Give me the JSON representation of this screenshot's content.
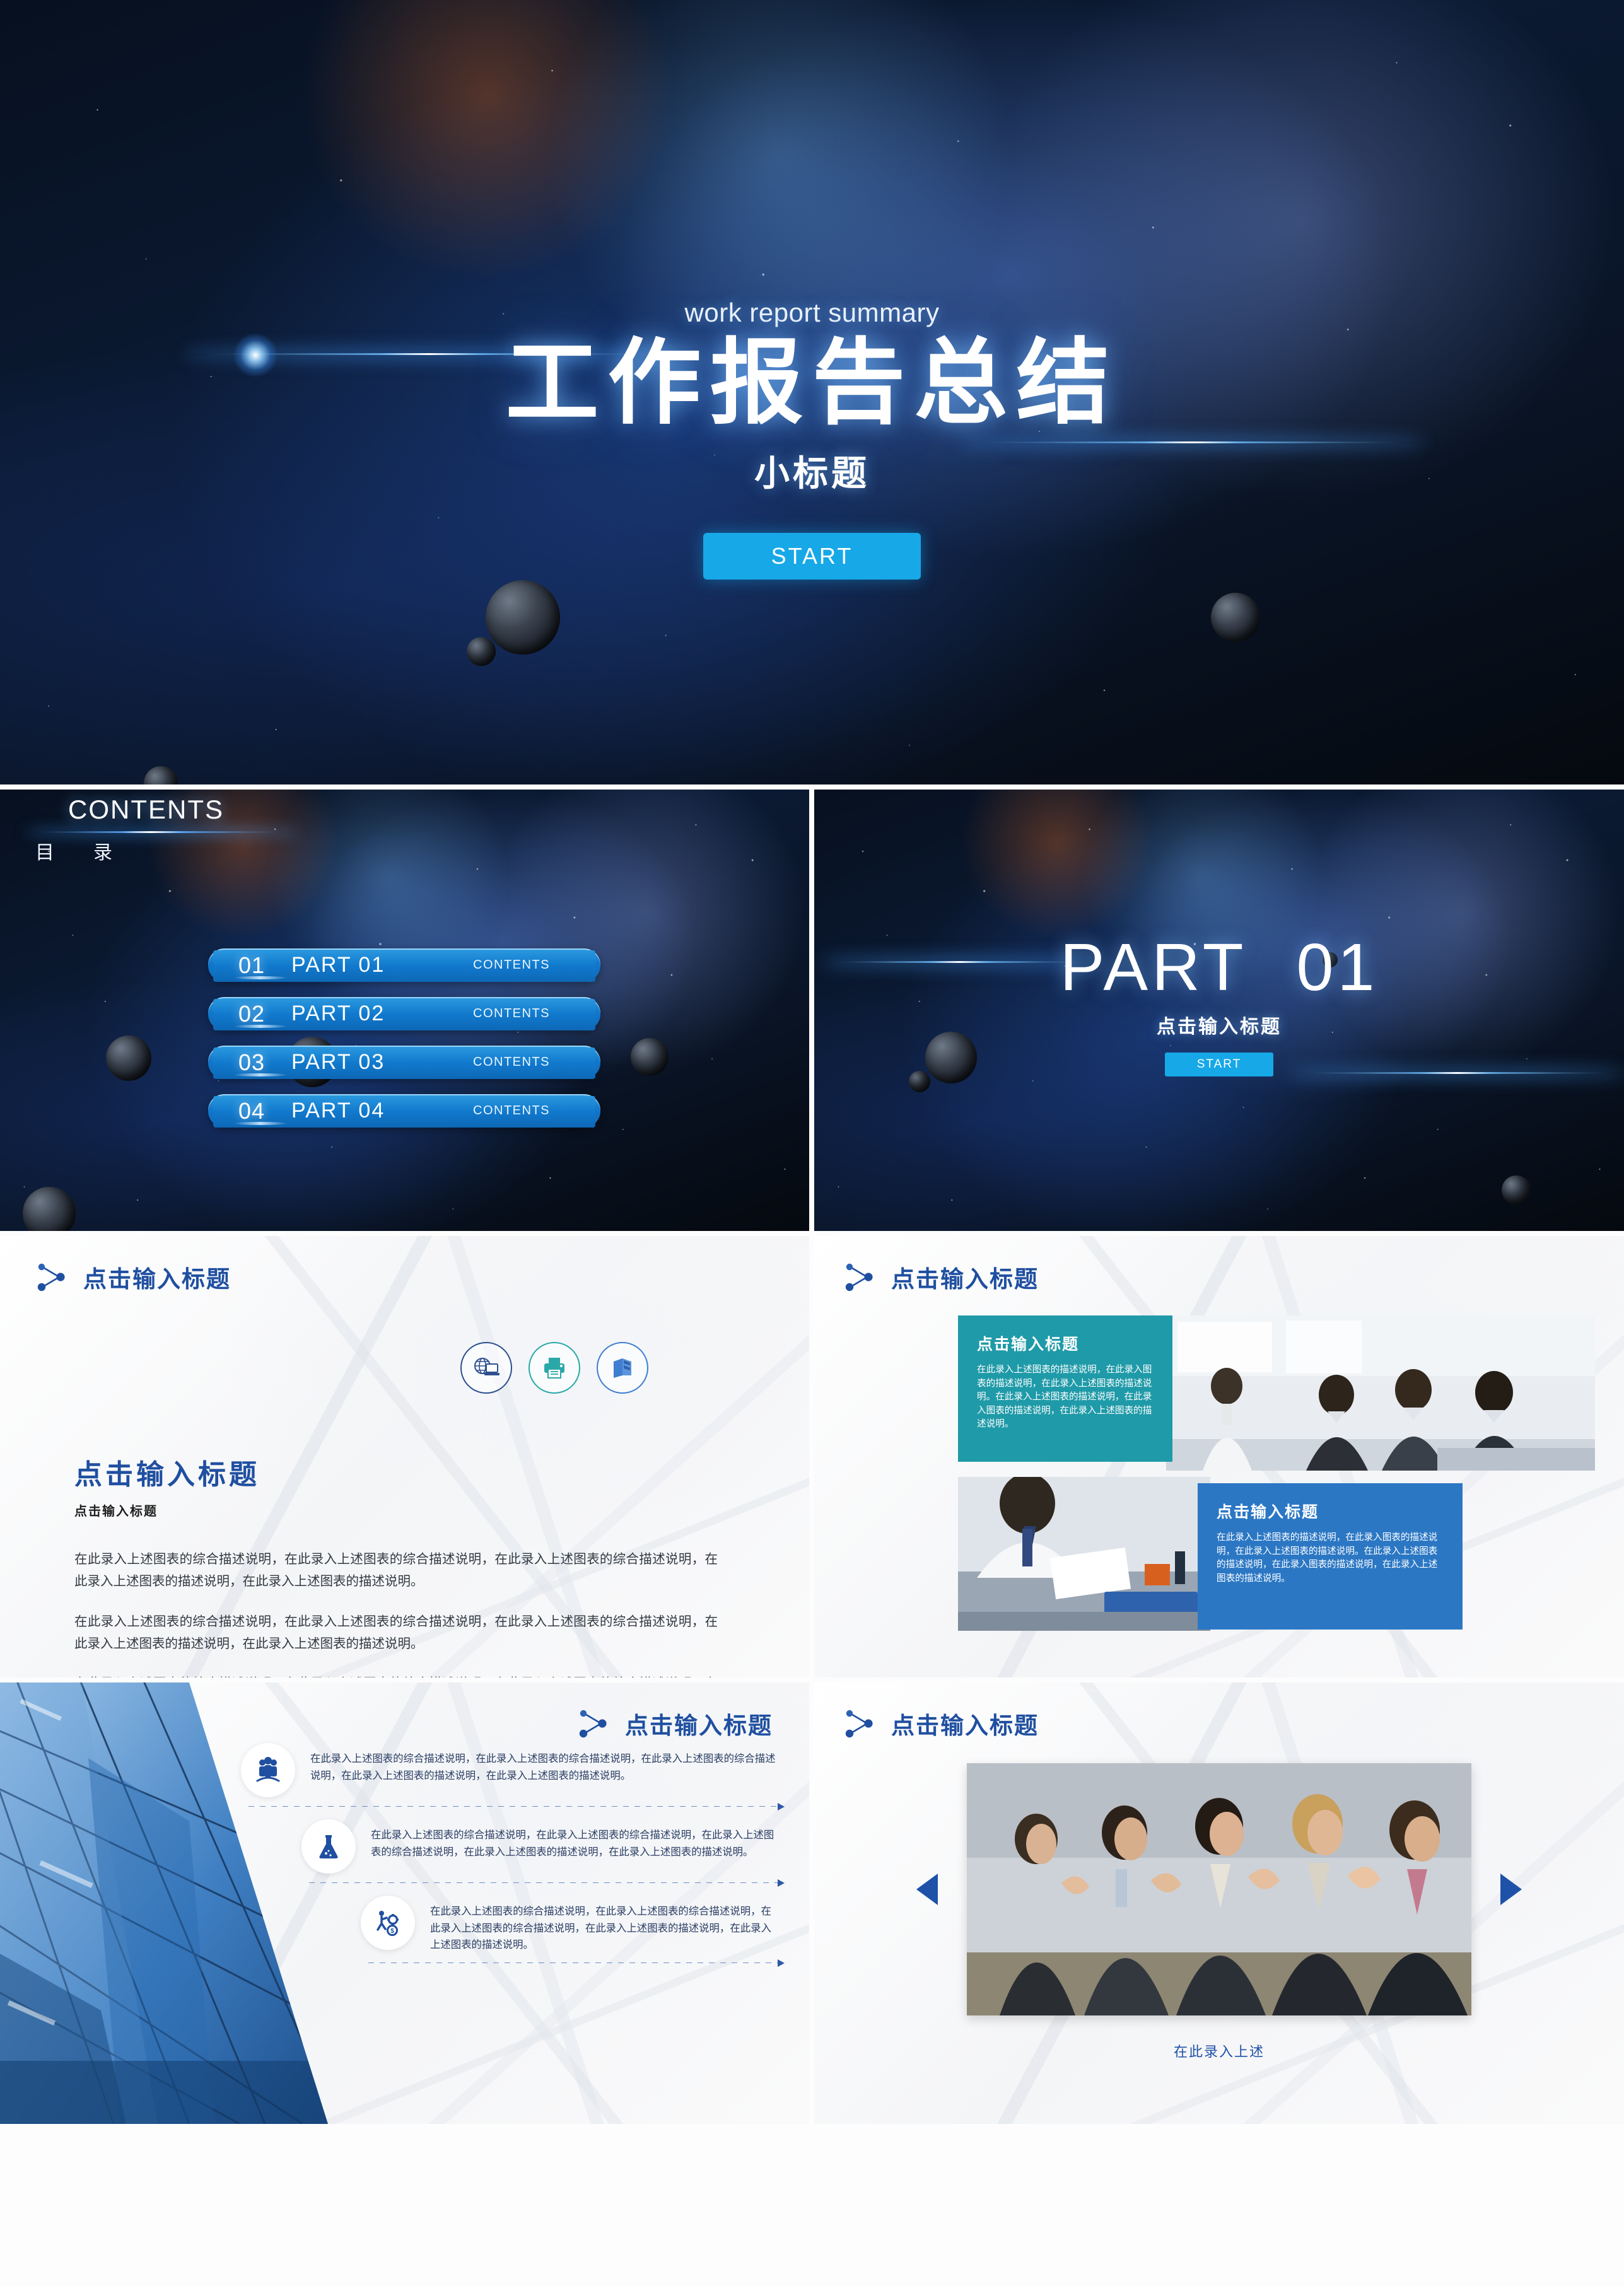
{
  "title_slide": {
    "eyebrow": "work report summary",
    "main_title": "工作报告总结",
    "sub_title": "小标题",
    "start_label": "START"
  },
  "contents_slide": {
    "heading_en": "CONTENTS",
    "heading_cn": "目　录",
    "items": [
      {
        "num": "01",
        "label": "PART  01",
        "tag": "CONTENTS"
      },
      {
        "num": "02",
        "label": "PART  02",
        "tag": "CONTENTS"
      },
      {
        "num": "03",
        "label": "PART  03",
        "tag": "CONTENTS"
      },
      {
        "num": "04",
        "label": "PART  04",
        "tag": "CONTENTS"
      }
    ]
  },
  "part_slide": {
    "part_word": "PART",
    "part_num": "01",
    "subtitle": "点击输入标题",
    "start_label": "START"
  },
  "slide_text": {
    "header_title": "点击输入标题",
    "block_title": "点击输入标题",
    "block_subtitle": "点击输入标题",
    "paragraphs": [
      "在此录入上述图表的综合描述说明，在此录入上述图表的综合描述说明，在此录入上述图表的综合描述说明，在此录入上述图表的描述说明，在此录入上述图表的描述说明。",
      "在此录入上述图表的综合描述说明，在此录入上述图表的综合描述说明，在此录入上述图表的综合描述说明，在此录入上述图表的描述说明，在此录入上述图表的描述说明。",
      "在此录入上述图表的综合描述说明，在此录入上述图表的综合描述说明，在此录入上述图表的综合描述说明，在此录入上述图表的描述说明。"
    ],
    "icons": [
      "globe-laptop-icon",
      "printer-icon",
      "book-icon"
    ]
  },
  "slide_cards": {
    "header_title": "点击输入标题",
    "teal_card": {
      "title": "点击输入标题",
      "body": "在此录入上述图表的描述说明，在此录入图表的描述说明，在此录入上述图表的描述说明。在此录入上述图表的描述说明，在此录入图表的描述说明，在此录入上述图表的描述说明。",
      "color": "#1f9aa8"
    },
    "blue_card": {
      "title": "点击输入标题",
      "body": "在此录入上述图表的描述说明，在此录入图表的描述说明，在此录入上述图表的描述说明。在此录入上述图表的描述说明，在此录入图表的描述说明，在此录入上述图表的描述说明。",
      "color": "#2b77c4"
    }
  },
  "slide_list": {
    "header_title": "点击输入标题",
    "rows": [
      {
        "icon": "people-group-icon",
        "text": "在此录入上述图表的综合描述说明，在此录入上述图表的综合描述说明，在此录入上述图表的综合描述说明，在此录入上述图表的描述说明，在此录入上述图表的描述说明。"
      },
      {
        "icon": "flask-icon",
        "text": "在此录入上述图表的综合描述说明，在此录入上述图表的综合描述说明，在此录入上述图表的综合描述说明，在此录入上述图表的描述说明，在此录入上述图表的描述说明。"
      },
      {
        "icon": "person-gear-money-icon",
        "text": "在此录入上述图表的综合描述说明，在此录入上述图表的综合描述说明，在此录入上述图表的综合描述说明，在此录入上述图表的描述说明，在此录入上述图表的描述说明。"
      }
    ]
  },
  "slide_gallery": {
    "header_title": "点击输入标题",
    "caption": "在此录入上述",
    "prev_icon": "arrow-left-icon",
    "next_icon": "arrow-right-icon"
  },
  "colors": {
    "accent_blue": "#17a8e8",
    "deep_blue": "#1f4fa0",
    "teal": "#1f9aa8",
    "card_blue": "#2b77c4",
    "toc_bar": "#1179cd"
  }
}
